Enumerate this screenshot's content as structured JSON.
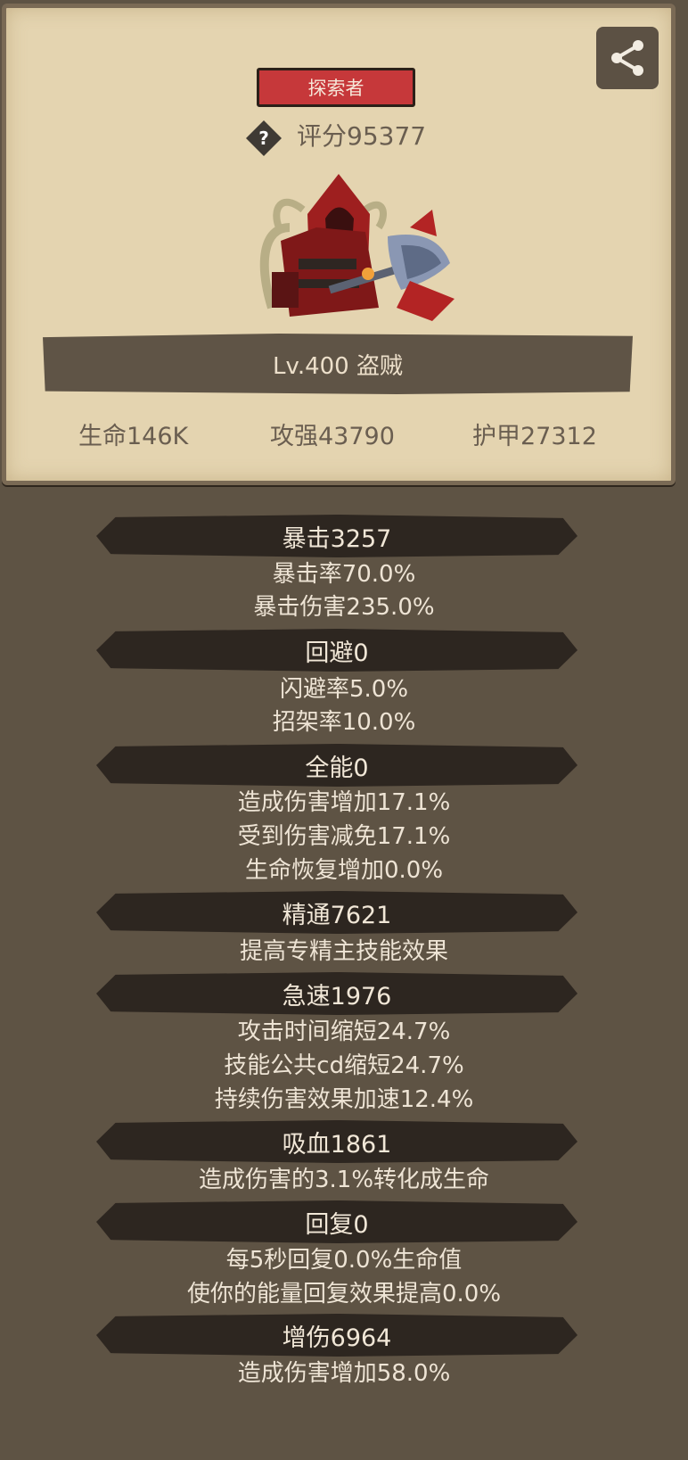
{
  "header": {
    "title_badge": "探索者",
    "score": "评分95377",
    "level_class": "Lv.400 盗贼",
    "top_stats": [
      "生命146K",
      "攻强43790",
      "护甲27312"
    ]
  },
  "icons": {
    "share": "share-icon",
    "help": "question-diamond-icon",
    "character": "hooded-rogue-character"
  },
  "sections": [
    {
      "title": "暴击3257",
      "lines": [
        "暴击率70.0%",
        "暴击伤害235.0%"
      ]
    },
    {
      "title": "回避0",
      "lines": [
        "闪避率5.0%",
        "招架率10.0%"
      ]
    },
    {
      "title": "全能0",
      "lines": [
        "造成伤害增加17.1%",
        "受到伤害减免17.1%",
        "生命恢复增加0.0%"
      ]
    },
    {
      "title": "精通7621",
      "lines": [
        "提高专精主技能效果"
      ]
    },
    {
      "title": "急速1976",
      "lines": [
        "攻击时间缩短24.7%",
        "技能公共cd缩短24.7%",
        "持续伤害效果加速12.4%"
      ]
    },
    {
      "title": "吸血1861",
      "lines": [
        "造成伤害的3.1%转化成生命"
      ]
    },
    {
      "title": "回复0",
      "lines": [
        "每5秒回复0.0%生命值",
        "使你的能量回复效果提高0.0%"
      ]
    },
    {
      "title": "增伤6964",
      "lines": [
        "造成伤害增加58.0%"
      ]
    }
  ],
  "colors": {
    "background": "#5e5344",
    "parchment": "#e4d4b0",
    "badge_red": "#c6383a",
    "section_bar": "#2d2620"
  }
}
